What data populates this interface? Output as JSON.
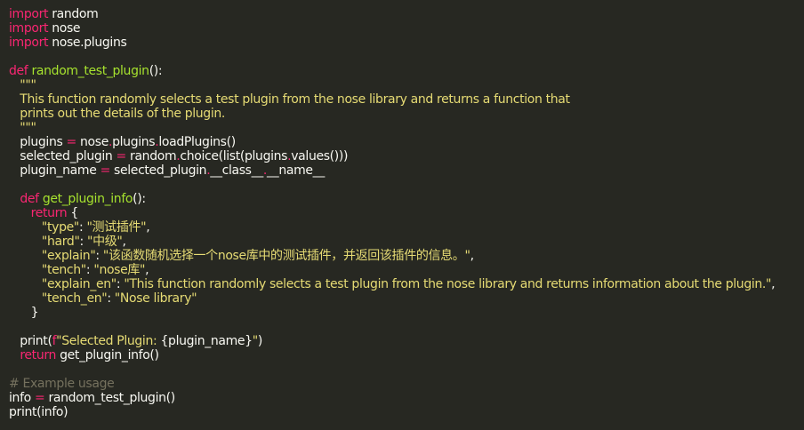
{
  "editor": {
    "theme": {
      "background": "#272822",
      "keyword": "#f92672",
      "function": "#a6e22e",
      "string": "#e6db74",
      "comment": "#75715e",
      "text": "#f8f8f2"
    },
    "lines": [
      [
        {
          "t": "kw",
          "v": "import"
        },
        {
          "t": "tx",
          "v": " random"
        }
      ],
      [
        {
          "t": "kw",
          "v": "import"
        },
        {
          "t": "tx",
          "v": " nose"
        }
      ],
      [
        {
          "t": "kw",
          "v": "import"
        },
        {
          "t": "tx",
          "v": " nose.plugins"
        }
      ],
      [],
      [
        {
          "t": "kw",
          "v": "def"
        },
        {
          "t": "tx",
          "v": " "
        },
        {
          "t": "fn",
          "v": "random_test_plugin"
        },
        {
          "t": "tx",
          "v": "():"
        }
      ],
      [
        {
          "t": "str",
          "v": "   \"\"\""
        }
      ],
      [
        {
          "t": "str",
          "v": "   This function randomly selects a test plugin from the nose library and returns a function that"
        }
      ],
      [
        {
          "t": "str",
          "v": "   prints out the details of the plugin."
        }
      ],
      [
        {
          "t": "str",
          "v": "   \"\"\""
        }
      ],
      [
        {
          "t": "tx",
          "v": "   plugins "
        },
        {
          "t": "kw",
          "v": "="
        },
        {
          "t": "tx",
          "v": " nose"
        },
        {
          "t": "kw",
          "v": "."
        },
        {
          "t": "tx",
          "v": "plugins"
        },
        {
          "t": "kw",
          "v": "."
        },
        {
          "t": "tx",
          "v": "loadPlugins()"
        }
      ],
      [
        {
          "t": "tx",
          "v": "   selected_plugin "
        },
        {
          "t": "kw",
          "v": "="
        },
        {
          "t": "tx",
          "v": " random"
        },
        {
          "t": "kw",
          "v": "."
        },
        {
          "t": "tx",
          "v": "choice(list(plugins"
        },
        {
          "t": "kw",
          "v": "."
        },
        {
          "t": "tx",
          "v": "values()))"
        }
      ],
      [
        {
          "t": "tx",
          "v": "   plugin_name "
        },
        {
          "t": "kw",
          "v": "="
        },
        {
          "t": "tx",
          "v": " selected_plugin"
        },
        {
          "t": "kw",
          "v": "."
        },
        {
          "t": "tx",
          "v": "__class__"
        },
        {
          "t": "kw",
          "v": "."
        },
        {
          "t": "tx",
          "v": "__name__"
        }
      ],
      [],
      [
        {
          "t": "tx",
          "v": "   "
        },
        {
          "t": "kw",
          "v": "def"
        },
        {
          "t": "tx",
          "v": " "
        },
        {
          "t": "fn",
          "v": "get_plugin_info"
        },
        {
          "t": "tx",
          "v": "():"
        }
      ],
      [
        {
          "t": "tx",
          "v": "      "
        },
        {
          "t": "kw",
          "v": "return"
        },
        {
          "t": "tx",
          "v": " {"
        }
      ],
      [
        {
          "t": "tx",
          "v": "         "
        },
        {
          "t": "str",
          "v": "\"type\""
        },
        {
          "t": "tx",
          "v": ": "
        },
        {
          "t": "str",
          "v": "\"测试插件\""
        },
        {
          "t": "tx",
          "v": ","
        }
      ],
      [
        {
          "t": "tx",
          "v": "         "
        },
        {
          "t": "str",
          "v": "\"hard\""
        },
        {
          "t": "tx",
          "v": ": "
        },
        {
          "t": "str",
          "v": "\"中级\""
        },
        {
          "t": "tx",
          "v": ","
        }
      ],
      [
        {
          "t": "tx",
          "v": "         "
        },
        {
          "t": "str",
          "v": "\"explain\""
        },
        {
          "t": "tx",
          "v": ": "
        },
        {
          "t": "str",
          "v": "\"该函数随机选择一个nose库中的测试插件，并返回该插件的信息。\""
        },
        {
          "t": "tx",
          "v": ","
        }
      ],
      [
        {
          "t": "tx",
          "v": "         "
        },
        {
          "t": "str",
          "v": "\"tench\""
        },
        {
          "t": "tx",
          "v": ": "
        },
        {
          "t": "str",
          "v": "\"nose库\""
        },
        {
          "t": "tx",
          "v": ","
        }
      ],
      [
        {
          "t": "tx",
          "v": "         "
        },
        {
          "t": "str",
          "v": "\"explain_en\""
        },
        {
          "t": "tx",
          "v": ": "
        },
        {
          "t": "str",
          "v": "\"This function randomly selects a test plugin from the nose library and returns information about the plugin.\""
        },
        {
          "t": "tx",
          "v": ","
        }
      ],
      [
        {
          "t": "tx",
          "v": "         "
        },
        {
          "t": "str",
          "v": "\"tench_en\""
        },
        {
          "t": "tx",
          "v": ": "
        },
        {
          "t": "str",
          "v": "\"Nose library\""
        }
      ],
      [
        {
          "t": "tx",
          "v": "      }"
        }
      ],
      [],
      [
        {
          "t": "tx",
          "v": "   print("
        },
        {
          "t": "kw",
          "v": "f"
        },
        {
          "t": "str",
          "v": "\"Selected Plugin: "
        },
        {
          "t": "tx",
          "v": "{plugin_name}"
        },
        {
          "t": "str",
          "v": "\""
        },
        {
          "t": "tx",
          "v": ")"
        }
      ],
      [
        {
          "t": "tx",
          "v": "   "
        },
        {
          "t": "kw",
          "v": "return"
        },
        {
          "t": "tx",
          "v": " get_plugin_info()"
        }
      ],
      [],
      [
        {
          "t": "cm",
          "v": "# Example usage"
        }
      ],
      [
        {
          "t": "tx",
          "v": "info "
        },
        {
          "t": "kw",
          "v": "="
        },
        {
          "t": "tx",
          "v": " random_test_plugin()"
        }
      ],
      [
        {
          "t": "tx",
          "v": "print(info)"
        }
      ]
    ]
  }
}
